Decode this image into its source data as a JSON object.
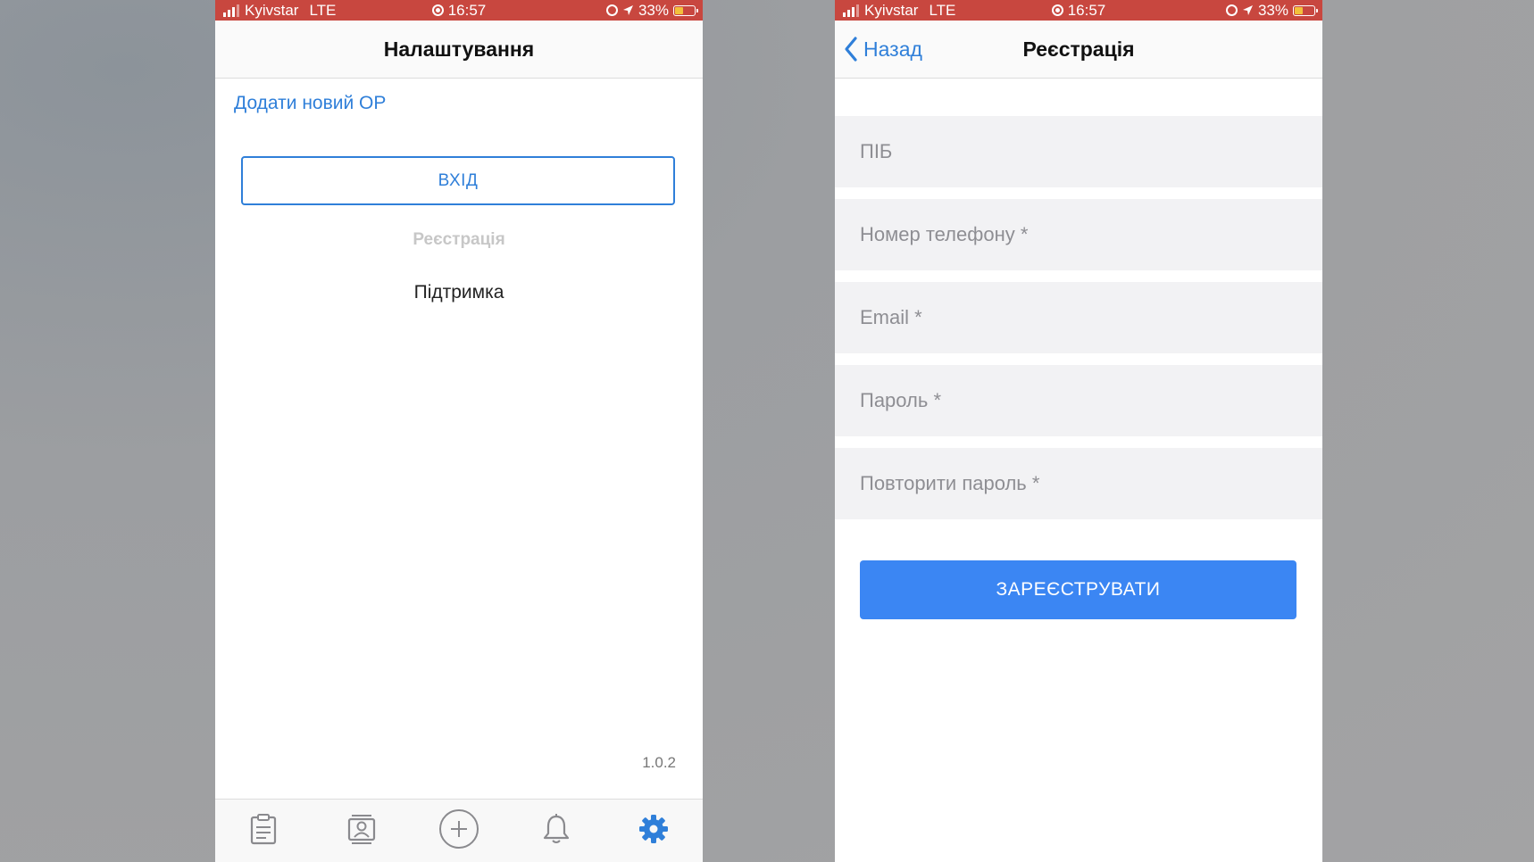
{
  "status_bar": {
    "carrier": "Kyivstar",
    "network": "LTE",
    "time": "16:57",
    "battery": "33%"
  },
  "settings_screen": {
    "title": "Налаштування",
    "add_link": "Додати новий ОР",
    "login_button": "ВХІД",
    "registration_link": "Реєстрація",
    "support_link": "Підтримка",
    "version": "1.0.2",
    "tabs": [
      {
        "icon": "clipboard-icon"
      },
      {
        "icon": "contact-card-icon"
      },
      {
        "icon": "plus-circle-icon"
      },
      {
        "icon": "bell-icon"
      },
      {
        "icon": "gear-icon",
        "active": true
      }
    ]
  },
  "registration_screen": {
    "back_label": "Назад",
    "title": "Реєстрація",
    "fields": [
      {
        "placeholder": "ПІБ"
      },
      {
        "placeholder": "Номер телефону *"
      },
      {
        "placeholder": "Email *"
      },
      {
        "placeholder": "Пароль *"
      },
      {
        "placeholder": "Повторити пароль *"
      }
    ],
    "submit_button": "ЗАРЕЄСТРУВАТИ"
  },
  "colors": {
    "status_bar": "#c8473f",
    "accent": "#2f7fd9",
    "primary_button": "#3b86f3",
    "input_background": "#f2f2f4",
    "disabled_text": "#c7c7c7"
  }
}
